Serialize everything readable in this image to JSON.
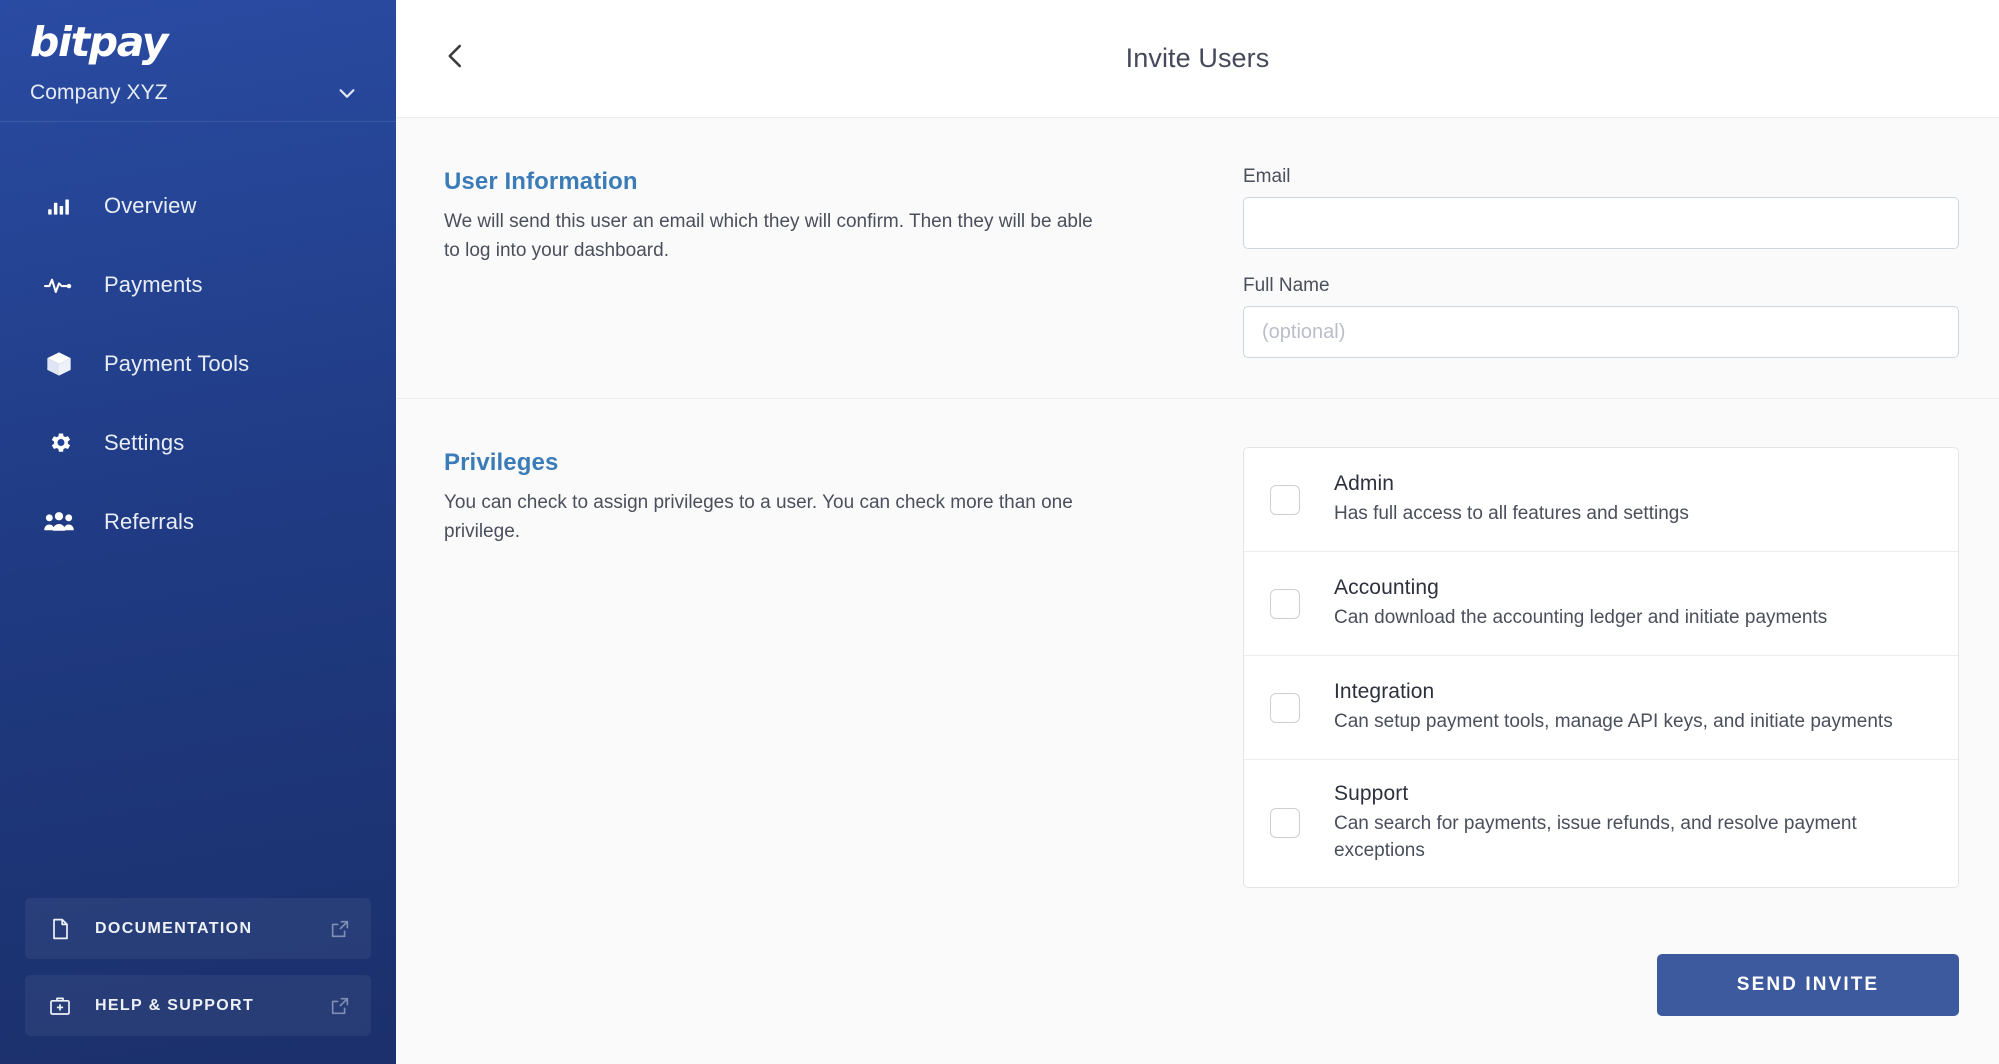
{
  "sidebar": {
    "logo_text": "bitpay",
    "company": {
      "name": "Company XYZ",
      "chevron_icon": "chevron-down-icon"
    },
    "nav_items": [
      {
        "label": "Overview",
        "icon": "bar-chart-icon"
      },
      {
        "label": "Payments",
        "icon": "activity-pulse-icon"
      },
      {
        "label": "Payment Tools",
        "icon": "box-3d-icon"
      },
      {
        "label": "Settings",
        "icon": "gear-icon"
      },
      {
        "label": "Referrals",
        "icon": "users-group-icon"
      }
    ],
    "bottom_items": [
      {
        "label": "DOCUMENTATION",
        "icon": "document-icon",
        "trailing_icon": "external-link-icon"
      },
      {
        "label": "HELP & SUPPORT",
        "icon": "first-aid-kit-icon",
        "trailing_icon": "external-link-icon"
      }
    ],
    "colors": {
      "gradient_top": "#2a4ba3",
      "gradient_bottom": "#1b306c"
    }
  },
  "header": {
    "back_icon": "chevron-left-icon",
    "title": "Invite Users"
  },
  "sections": {
    "user_information": {
      "title": "User Information",
      "description": "We will send this user an email which they will confirm. Then they will be able to log into your dashboard.",
      "fields": {
        "email": {
          "label": "Email",
          "value": "",
          "placeholder": ""
        },
        "full_name": {
          "label": "Full Name",
          "value": "",
          "placeholder": "(optional)"
        }
      }
    },
    "privileges": {
      "title": "Privileges",
      "description": "You can check to assign privileges to a user. You can check more than one privilege.",
      "options": [
        {
          "name": "Admin",
          "description": "Has full access to all features and settings",
          "checked": false
        },
        {
          "name": "Accounting",
          "description": "Can download the accounting ledger and initiate payments",
          "checked": false
        },
        {
          "name": "Integration",
          "description": "Can setup payment tools, manage API keys, and initiate payments",
          "checked": false
        },
        {
          "name": "Support",
          "description": "Can search for payments, issue refunds, and resolve payment exceptions",
          "checked": false
        }
      ]
    }
  },
  "footer": {
    "send_invite_label": "SEND INVITE",
    "accent_color": "#3d5a9e"
  },
  "theme": {
    "section_title_color": "#3b7cb8",
    "body_text_color": "#4a4f5c",
    "content_bg": "#fafafa"
  }
}
